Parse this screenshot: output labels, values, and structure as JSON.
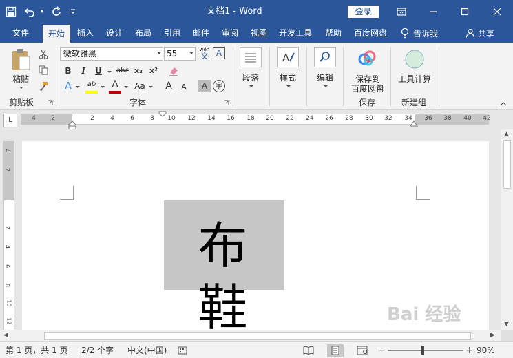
{
  "titlebar": {
    "doc_title": "文档1 - Word",
    "login_label": "登录"
  },
  "tabs": {
    "items": [
      "文件",
      "开始",
      "插入",
      "设计",
      "布局",
      "引用",
      "邮件",
      "审阅",
      "视图",
      "开发工具",
      "帮助",
      "百度网盘"
    ],
    "active": "开始",
    "tellme": "告诉我",
    "share": "共享"
  },
  "ribbon": {
    "clipboard": {
      "paste": "粘贴",
      "group": "剪贴板"
    },
    "font": {
      "family": "微软雅黑",
      "size": "55",
      "wen_label": "wén",
      "wen_char": "文",
      "bold": "B",
      "italic": "I",
      "underline": "U",
      "strike": "abc",
      "sub": "x₂",
      "sup": "x²",
      "grow": "A",
      "shrink": "A",
      "case": "Aa",
      "highlight": "ab",
      "color_a": "A",
      "effects_a": "A",
      "char_shade": "A",
      "enclosed": "字",
      "group": "字体"
    },
    "paragraph": {
      "label": "段落"
    },
    "styles": {
      "label": "样式"
    },
    "editing": {
      "label": "编辑"
    },
    "save": {
      "label_line1": "保存到",
      "label_line2": "百度网盘",
      "group": "保存"
    },
    "tools": {
      "label": "工具计算",
      "group": "新建组"
    }
  },
  "ruler": {
    "corner": "L",
    "left_ticks": [
      "4",
      "2"
    ],
    "ticks": [
      "2",
      "4",
      "6",
      "8",
      "10",
      "12",
      "14",
      "16",
      "18",
      "20",
      "22",
      "24",
      "26",
      "28",
      "30",
      "32",
      "34"
    ],
    "right_ticks": [
      "36",
      "38",
      "40",
      "42"
    ],
    "vertical_ticks": [
      "4",
      "2",
      "2",
      "4",
      "6",
      "8",
      "10",
      "12"
    ]
  },
  "document": {
    "text": "布 鞋"
  },
  "status": {
    "page": "第 1 页，共 1 页",
    "words": "2/2 个字",
    "language": "中文(中国)",
    "zoom": "90%",
    "zoom_minus": "−",
    "zoom_plus": "+"
  },
  "watermark": "Bai 经验",
  "colors": {
    "brand": "#2b579a",
    "highlight": "#ffff00",
    "font_color": "#c00000",
    "selection": "#c6c6c6"
  }
}
